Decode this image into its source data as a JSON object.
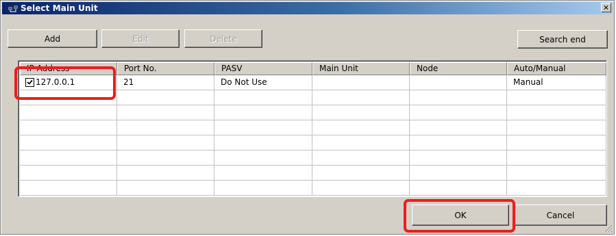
{
  "window": {
    "title": "Select Main Unit",
    "close_glyph": "✕"
  },
  "toolbar": {
    "add_label": "Add",
    "edit_label": "Edit",
    "delete_label": "Delete",
    "search_end_label": "Search end"
  },
  "table": {
    "columns": [
      "IP Address",
      "Port No.",
      "PASV",
      "Main Unit",
      "Node",
      "Auto/Manual"
    ],
    "rows": [
      {
        "checked": true,
        "cells": [
          "127.0.0.1",
          "21",
          "Do Not Use",
          "",
          "",
          "Manual"
        ]
      }
    ],
    "empty_rows": 7
  },
  "footer": {
    "ok_label": "OK",
    "cancel_label": "Cancel"
  },
  "highlights": {
    "color": "#ee1c1c",
    "targets": [
      "ip-address-cell",
      "ok-button"
    ]
  },
  "colors": {
    "dialog_face": "#d4d0c8",
    "title_start": "#0a246a",
    "title_end": "#a6caf0"
  }
}
